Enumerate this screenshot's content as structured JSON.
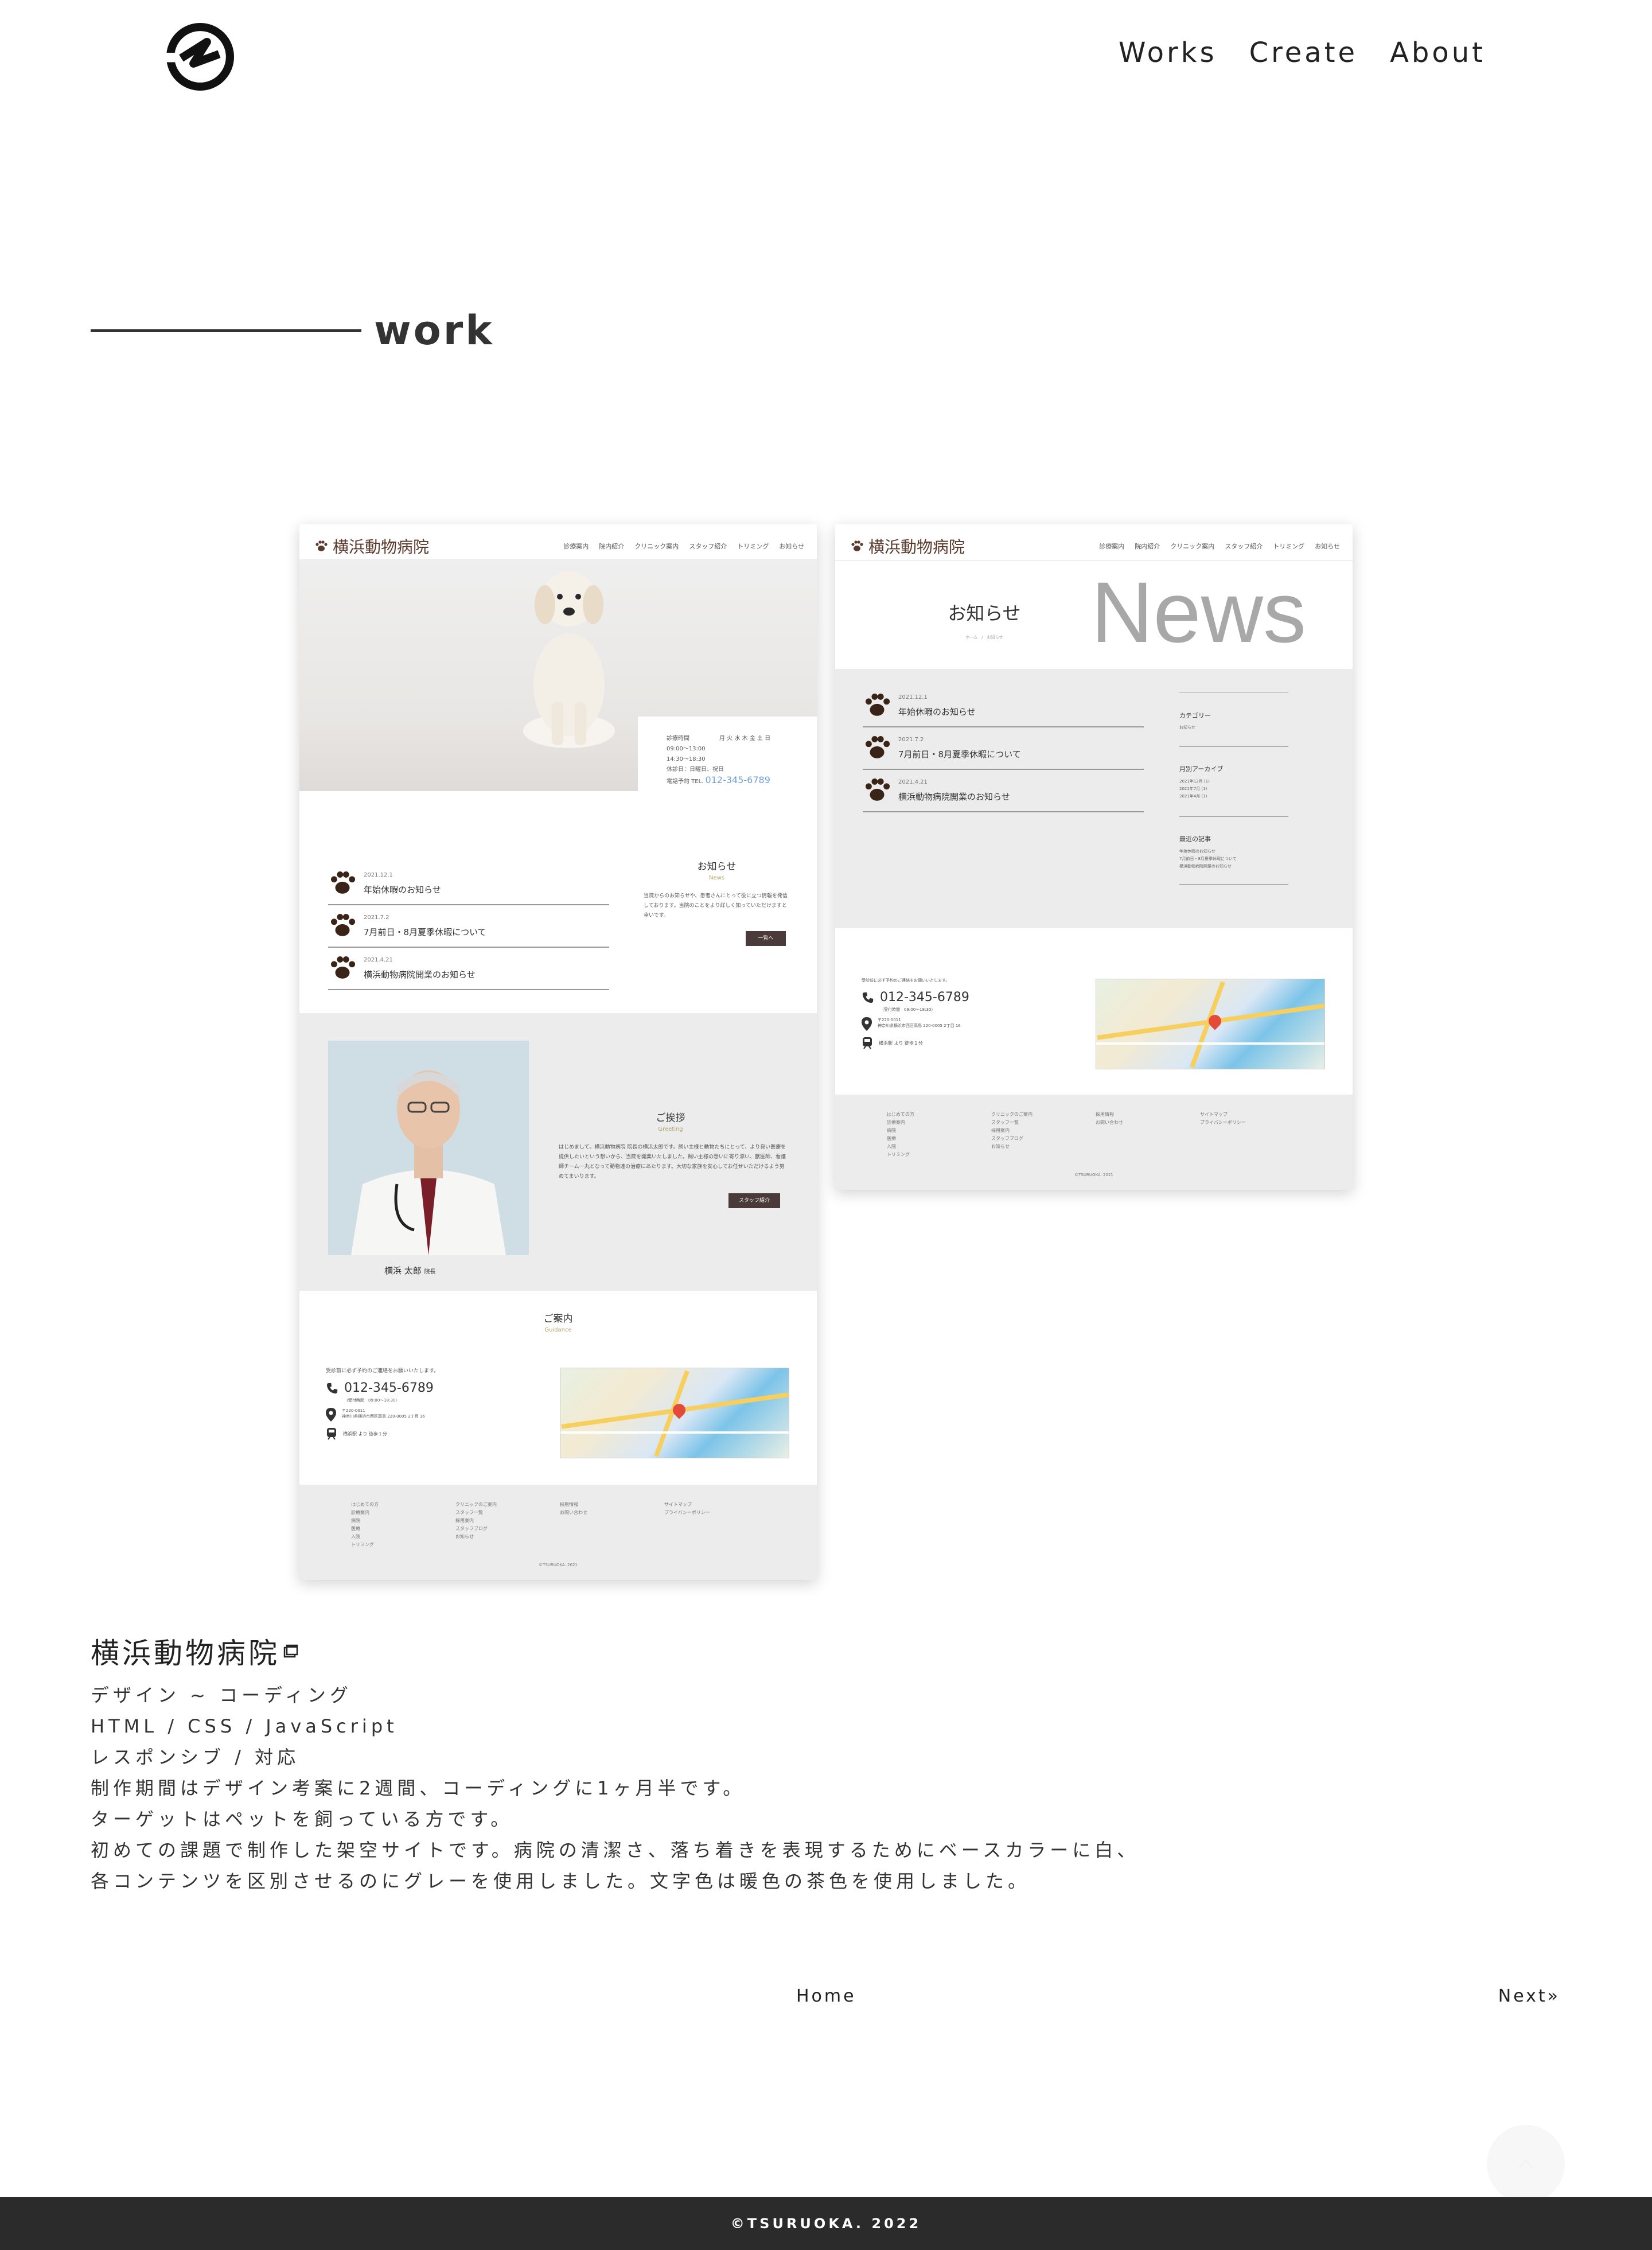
{
  "header": {
    "logo_icon": "tsuruoka-logo-icon",
    "nav": [
      "Works",
      "Create",
      "About"
    ]
  },
  "section": {
    "title": "work"
  },
  "mockup_home": {
    "brand": "横浜動物病院",
    "nav": [
      "診療案内",
      "院内紹介",
      "クリニック案内",
      "スタッフ紹介",
      "トリミング",
      "お知らせ"
    ],
    "hours": {
      "label": "診療時間",
      "days": "月 火 水 木 金 土 日",
      "row1": "09:00〜13:00",
      "row2": "14:30〜18:30",
      "closed": "休診日：日曜日、祝日",
      "tel_label": "電話予約 TEL.",
      "tel": "012-345-6789"
    },
    "news": [
      {
        "date": "2021.12.1",
        "title": "年始休暇のお知らせ"
      },
      {
        "date": "2021.7.2",
        "title": "7月前日・8月夏季休暇について"
      },
      {
        "date": "2021.4.21",
        "title": "横浜動物病院開業のお知らせ"
      }
    ],
    "news_heading": "お知らせ",
    "news_sub": "News",
    "news_text": "当院からのお知らせや、患者さんにとって役に立つ情報を発信しております。当院のことをより詳しく知っていただけますと幸いです。",
    "news_button": "一覧へ",
    "greeting_heading": "ご挨拶",
    "greeting_sub": "Greeting",
    "greeting_text": "はじめまして。横浜動物病院 院長の横浜太郎です。飼い主様と動物たちにとって、より良い医療を提供したいという想いから、当院を開業いたしました。飼い主様の想いに寄り添い、獣医師、看護師チーム一丸となって動物達の治療にあたります。大切な家族を安心してお任せいただけるよう努めてまいります。",
    "greeting_button": "スタッフ紹介",
    "doctor_name": "横浜 太郎",
    "doctor_role": "院長",
    "guide_heading": "ご案内",
    "guide_sub": "Guidance",
    "guide_note": "受診前に必ず予約のご連絡をお願いいたします。",
    "tel": "012-345-6789",
    "tel_hours": "（受付時間　09:00〜18:30）",
    "postal": "〒220-0011",
    "address": "神奈川県横浜市西区高島 220-0005 2丁目 16",
    "station": "横浜駅 より 徒歩１分",
    "footer_cols": [
      [
        "はじめての方",
        "診療案内",
        "病院",
        "医療",
        "入院",
        "トリミング"
      ],
      [
        "クリニックのご案内",
        "スタッフ一覧",
        "採用案内",
        "スタッフブログ",
        "お知らせ"
      ],
      [
        "採用情報",
        "お問い合わせ"
      ],
      [
        "サイトマップ",
        "プライバシーポリシー"
      ]
    ],
    "copyright": "©TSURUOKA. 2021"
  },
  "mockup_news": {
    "brand": "横浜動物病院",
    "nav": [
      "診療案内",
      "院内紹介",
      "クリニック案内",
      "スタッフ紹介",
      "トリミング",
      "お知らせ"
    ],
    "page_heading": "お知らせ",
    "page_big": "News",
    "breadcrumb": "ホーム　/　お知らせ",
    "news": [
      {
        "date": "2021.12.1",
        "title": "年始休暇のお知らせ"
      },
      {
        "date": "2021.7.2",
        "title": "7月前日・8月夏季休暇について"
      },
      {
        "date": "2021.4.21",
        "title": "横浜動物病院開業のお知らせ"
      }
    ],
    "side_category": "カテゴリー",
    "side_category_item": "お知らせ",
    "side_archive": "月別アーカイブ",
    "side_archive_items": [
      "2021年12月 (1)",
      "2021年7月 (1)",
      "2021年4月 (1)"
    ],
    "side_recent": "最近の記事",
    "side_recent_items": [
      "年始休暇のお知らせ",
      "7月前日・8月夏季休暇について",
      "横浜動物病院開業のお知らせ"
    ],
    "guide_note": "受診前に必ず予約のご連絡をお願いいたします。",
    "tel": "012-345-6789",
    "tel_hours": "（受付時間　09:00〜18:30）",
    "postal": "〒220-0011",
    "address": "神奈川県横浜市西区高島 220-0005 2丁目 16",
    "station": "横浜駅 より 徒歩１分",
    "footer_cols": [
      [
        "はじめての方",
        "診療案内",
        "病院",
        "医療",
        "入院",
        "トリミング"
      ],
      [
        "クリニックのご案内",
        "スタッフ一覧",
        "採用案内",
        "スタッフブログ",
        "お知らせ"
      ],
      [
        "採用情報",
        "お問い合わせ"
      ],
      [
        "サイトマップ",
        "プライバシーポリシー"
      ]
    ],
    "copyright": "©TSURUOKA. 2021"
  },
  "description": {
    "title": "横浜動物病院",
    "title_icon": "external-link-icon",
    "lines": [
      "デザイン ~ コーディング",
      "HTML / CSS / JavaScript",
      "レスポンシブ / 対応",
      "制作期間はデザイン考案に2週間、コーディングに1ヶ月半です。",
      "ターゲットはペットを飼っている方です。",
      "初めての課題で制作した架空サイトです。病院の清潔さ、落ち着きを表現するためにベースカラーに白、",
      "各コンテンツを区別させるのにグレーを使用しました。文字色は暖色の茶色を使用しました。"
    ]
  },
  "pager": {
    "home": "Home",
    "next": "Next»"
  },
  "to_top_icon": "arrow-up-icon",
  "footer": {
    "copyright": "©TSURUOKA. 2022"
  },
  "colors": {
    "footer_bg": "#2b2b2b",
    "brand_brown": "#5a3a2c",
    "mock_gray": "#ececec"
  }
}
